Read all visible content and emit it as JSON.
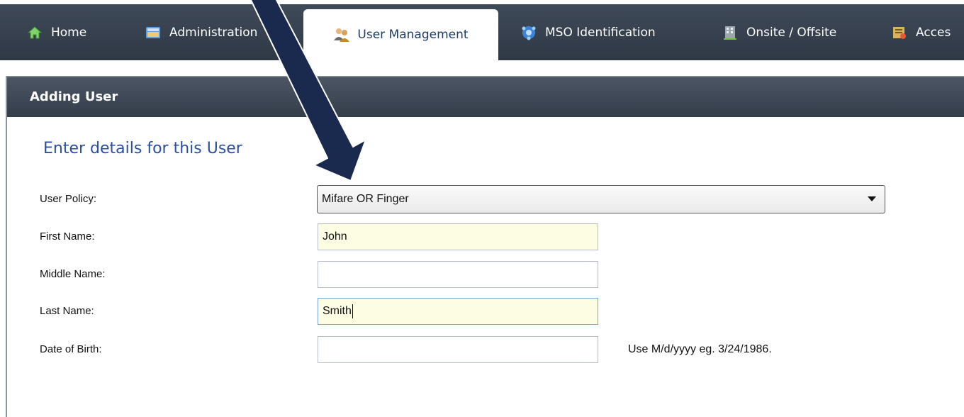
{
  "tabs": [
    {
      "label": "Home",
      "icon": "home-icon"
    },
    {
      "label": "Administration",
      "icon": "admin-icon"
    },
    {
      "label": "User Management",
      "icon": "users-icon",
      "active": true
    },
    {
      "label": "MSO Identification",
      "icon": "mso-icon"
    },
    {
      "label": "Onsite / Offsite",
      "icon": "building-icon"
    },
    {
      "label": "Acces",
      "icon": "access-icon"
    }
  ],
  "panel": {
    "title": "Adding User",
    "section_title": "Enter details for this User"
  },
  "form": {
    "user_policy_label": "User Policy:",
    "user_policy_value": "Mifare OR Finger",
    "first_name_label": "First Name:",
    "first_name_value": "John",
    "middle_name_label": "Middle Name:",
    "middle_name_value": "",
    "last_name_label": "Last Name:",
    "last_name_value": "Smith",
    "dob_label": "Date of Birth:",
    "dob_value": "",
    "dob_hint": "Use M/d/yyyy eg. 3/24/1986."
  },
  "colors": {
    "tabbar": "#36404d",
    "title_blue": "#2a4ea0",
    "arrow": "#1a2a4f",
    "filled_field": "#fdfde4"
  }
}
